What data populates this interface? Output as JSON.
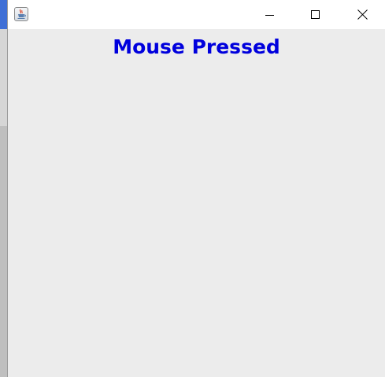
{
  "window": {
    "title": "",
    "app_icon": "java-coffee-cup-icon",
    "controls": {
      "minimize_icon": "minimize-icon",
      "maximize_icon": "maximize-icon",
      "close_icon": "close-icon"
    }
  },
  "content": {
    "message": "Mouse Pressed",
    "message_color": "#0000dd",
    "background_color": "#ececec"
  }
}
